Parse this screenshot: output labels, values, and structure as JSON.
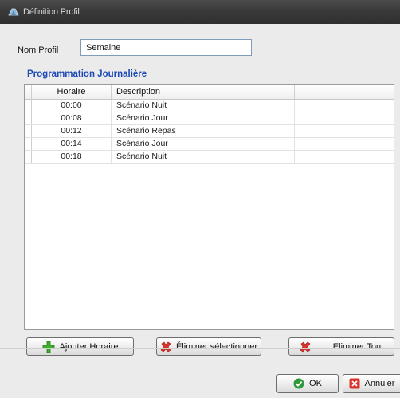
{
  "window": {
    "title": "Définition Profil"
  },
  "form": {
    "name_label": "Nom Profil",
    "name_value": "Semaine"
  },
  "section": {
    "title": "Programmation Journalière"
  },
  "table": {
    "headers": [
      "Horaire",
      "Description"
    ],
    "rows": [
      {
        "time": "00:00",
        "description": "Scénario Nuit"
      },
      {
        "time": "00:08",
        "description": "Scénario Jour"
      },
      {
        "time": "00:12",
        "description": "Scénario Repas"
      },
      {
        "time": "00:14",
        "description": "Scénario Jour"
      },
      {
        "time": "00:18",
        "description": "Scénario Nuit"
      }
    ]
  },
  "actions": {
    "add_label": "Ajouter Horaire",
    "remove_selected_label": "Éliminer sélectionner",
    "remove_all_label": "Eliminer Tout"
  },
  "dialog": {
    "ok_label": "OK",
    "cancel_label": "Annuler"
  },
  "icons": {
    "title": "profile-app-icon",
    "add": "plus-icon",
    "remove_selected": "red-x-icon",
    "remove_all": "red-x-icon",
    "ok": "green-check-icon",
    "cancel": "red-close-icon"
  },
  "colors": {
    "accent_blue": "#1c49b6",
    "add_green": "#3fae2a",
    "remove_red": "#d9342b",
    "ok_green": "#2f9a3a"
  }
}
